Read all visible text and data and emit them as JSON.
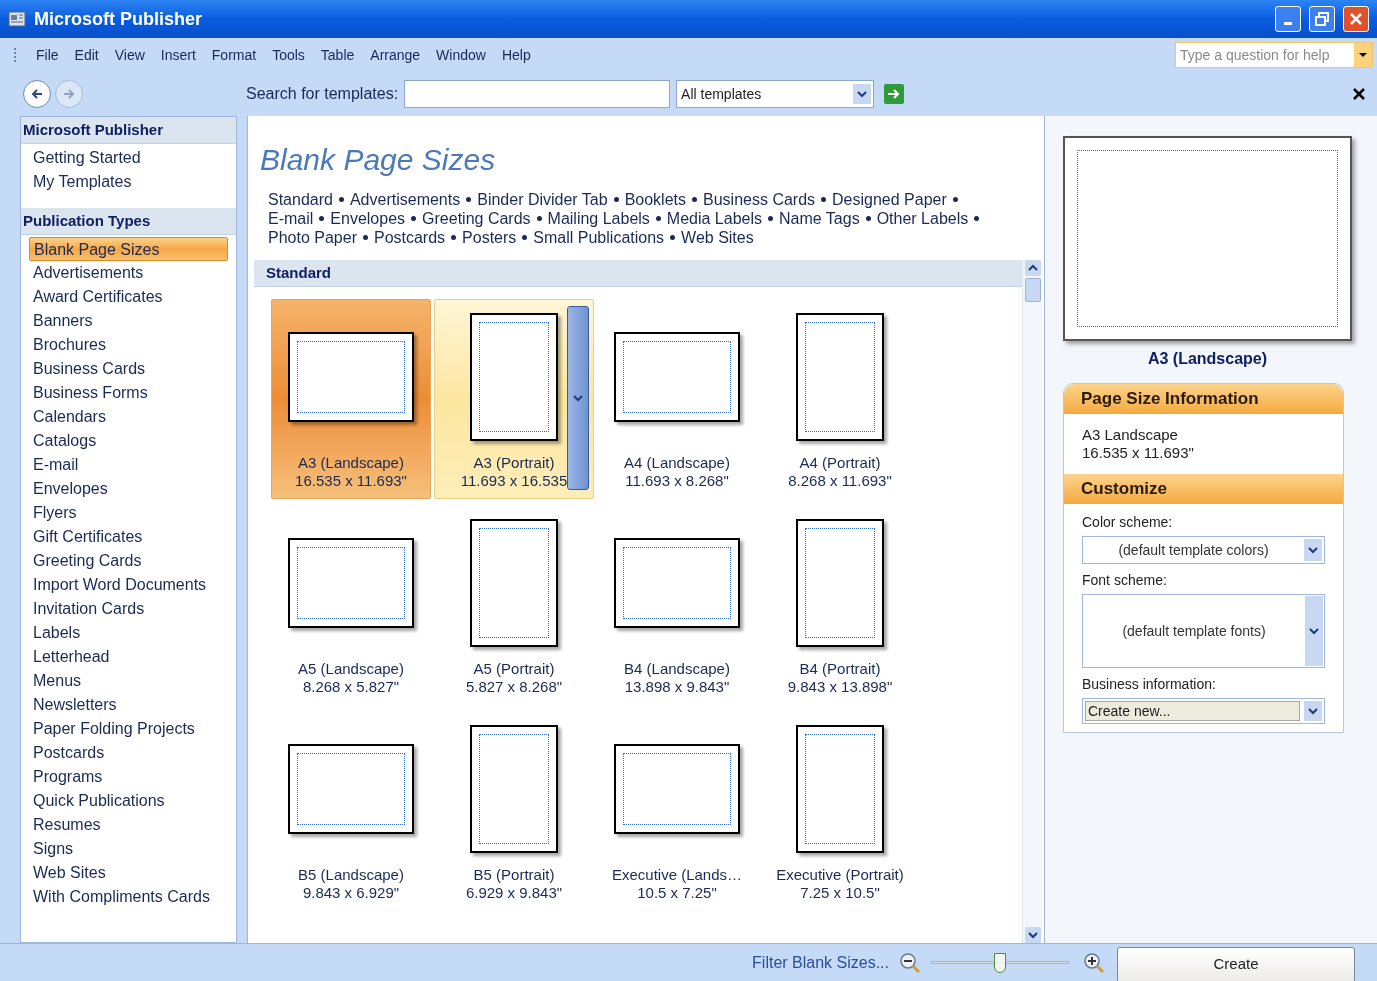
{
  "window": {
    "title": "Microsoft Publisher"
  },
  "menu": [
    "File",
    "Edit",
    "View",
    "Insert",
    "Format",
    "Tools",
    "Table",
    "Arrange",
    "Window",
    "Help"
  ],
  "help_box": {
    "placeholder": "Type a question for help"
  },
  "toolbar": {
    "search_label": "Search for templates:",
    "scope": "All templates"
  },
  "sidebar": [
    {
      "title": "Microsoft Publisher",
      "items": [
        {
          "label": "Getting Started",
          "selected": false
        },
        {
          "label": "My Templates",
          "selected": false
        }
      ]
    },
    {
      "title": "Publication Types",
      "items": [
        {
          "label": "Blank Page Sizes",
          "selected": true
        },
        {
          "label": "Advertisements",
          "selected": false
        },
        {
          "label": "Award Certificates",
          "selected": false
        },
        {
          "label": "Banners",
          "selected": false
        },
        {
          "label": "Brochures",
          "selected": false
        },
        {
          "label": "Business Cards",
          "selected": false
        },
        {
          "label": "Business Forms",
          "selected": false
        },
        {
          "label": "Calendars",
          "selected": false
        },
        {
          "label": "Catalogs",
          "selected": false
        },
        {
          "label": "E-mail",
          "selected": false
        },
        {
          "label": "Envelopes",
          "selected": false
        },
        {
          "label": "Flyers",
          "selected": false
        },
        {
          "label": "Gift Certificates",
          "selected": false
        },
        {
          "label": "Greeting Cards",
          "selected": false
        },
        {
          "label": "Import Word Documents",
          "selected": false
        },
        {
          "label": "Invitation Cards",
          "selected": false
        },
        {
          "label": "Labels",
          "selected": false
        },
        {
          "label": "Letterhead",
          "selected": false
        },
        {
          "label": "Menus",
          "selected": false
        },
        {
          "label": "Newsletters",
          "selected": false
        },
        {
          "label": "Paper Folding Projects",
          "selected": false
        },
        {
          "label": "Postcards",
          "selected": false
        },
        {
          "label": "Programs",
          "selected": false
        },
        {
          "label": "Quick Publications",
          "selected": false
        },
        {
          "label": "Resumes",
          "selected": false
        },
        {
          "label": "Signs",
          "selected": false
        },
        {
          "label": "Web Sites",
          "selected": false
        },
        {
          "label": "With Compliments Cards",
          "selected": false
        }
      ]
    }
  ],
  "gallery": {
    "title": "Blank Page Sizes",
    "links": [
      "Standard",
      "Advertisements",
      "Binder Divider Tab",
      "Booklets",
      "Business Cards",
      "Designed Paper",
      "E-mail",
      "Envelopes",
      "Greeting Cards",
      "Mailing Labels",
      "Media Labels",
      "Name Tags",
      "Other Labels",
      "Photo Paper",
      "Postcards",
      "Posters",
      "Small Publications",
      "Web Sites"
    ],
    "section": "Standard",
    "templates": [
      {
        "kind": "landscape",
        "name": "A3 (Landscape)",
        "size": "16.535 x 11.693\"",
        "selected": true,
        "hovered": false
      },
      {
        "kind": "portrait",
        "name": "A3 (Portrait)",
        "size": "11.693 x 16.535",
        "selected": false,
        "hovered": true
      },
      {
        "kind": "landscape",
        "name": "A4 (Landscape)",
        "size": "11.693 x 8.268\"",
        "selected": false,
        "hovered": false
      },
      {
        "kind": "portrait",
        "name": "A4 (Portrait)",
        "size": "8.268 x 11.693\"",
        "selected": false,
        "hovered": false
      },
      {
        "kind": "landscape",
        "name": "A5 (Landscape)",
        "size": "8.268 x 5.827\"",
        "selected": false,
        "hovered": false
      },
      {
        "kind": "portrait",
        "name": "A5 (Portrait)",
        "size": "5.827 x 8.268\"",
        "selected": false,
        "hovered": false
      },
      {
        "kind": "landscape",
        "name": "B4 (Landscape)",
        "size": "13.898 x 9.843\"",
        "selected": false,
        "hovered": false
      },
      {
        "kind": "portrait",
        "name": "B4 (Portrait)",
        "size": "9.843 x 13.898\"",
        "selected": false,
        "hovered": false
      },
      {
        "kind": "landscape",
        "name": "B5 (Landscape)",
        "size": "9.843 x 6.929\"",
        "selected": false,
        "hovered": false
      },
      {
        "kind": "portrait",
        "name": "B5 (Portrait)",
        "size": "6.929 x 9.843\"",
        "selected": false,
        "hovered": false
      },
      {
        "kind": "landscape",
        "name": "Executive (Lands…",
        "size": "10.5 x 7.25\"",
        "selected": false,
        "hovered": false
      },
      {
        "kind": "portrait",
        "name": "Executive (Portrait)",
        "size": "7.25 x 10.5\"",
        "selected": false,
        "hovered": false
      }
    ]
  },
  "preview": {
    "caption": "A3 (Landscape)"
  },
  "info": {
    "title": "Page Size Information",
    "lines": [
      "A3 Landscape",
      "16.535 x 11.693\""
    ]
  },
  "customize": {
    "title": "Customize",
    "color_label": "Color scheme:",
    "color_value": "(default template colors)",
    "font_label": "Font scheme:",
    "font_value": "(default template fonts)",
    "business_label": "Business information:",
    "business_value": "Create new..."
  },
  "bottom": {
    "filter": "Filter Blank Sizes...",
    "zoom": {
      "level": 0.5
    },
    "create": "Create"
  }
}
